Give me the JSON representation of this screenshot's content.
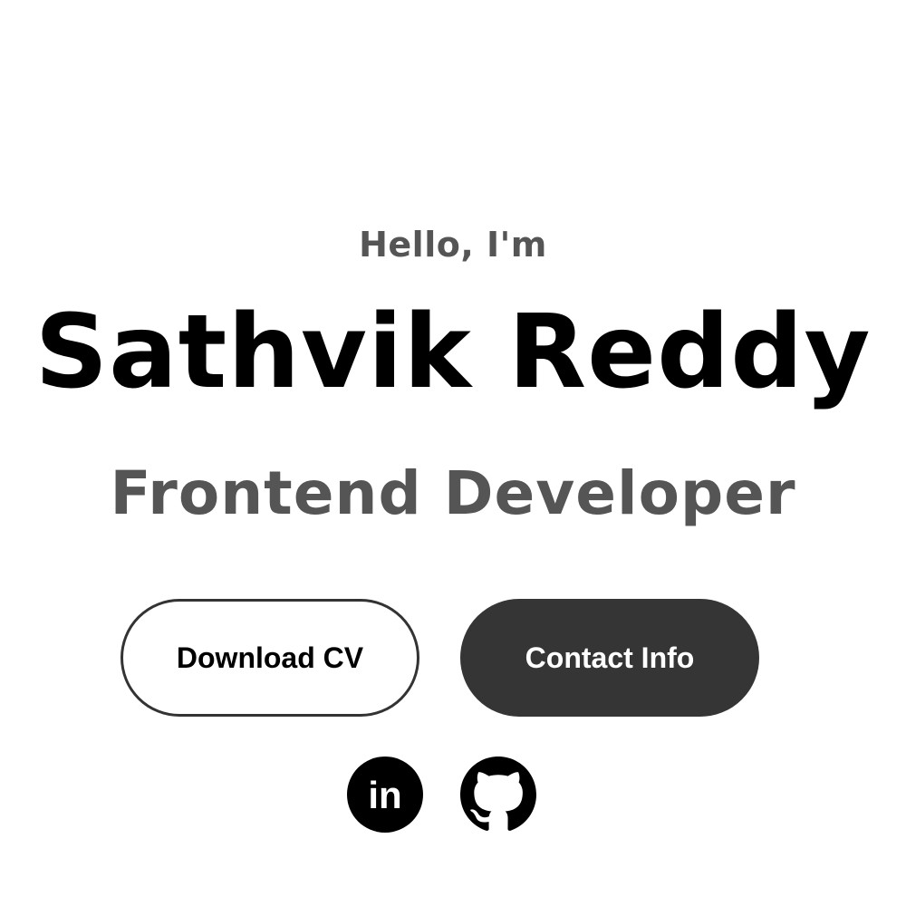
{
  "hero": {
    "greeting": "Hello, I'm",
    "name": "Sathvik Reddy",
    "role": "Frontend Developer"
  },
  "buttons": {
    "download_cv": "Download CV",
    "contact_info": "Contact Info"
  },
  "social": [
    {
      "icon": "linkedin-icon",
      "label": "in"
    },
    {
      "icon": "github-icon"
    }
  ],
  "colors": {
    "primary_text": "#000000",
    "secondary_text": "#555555",
    "button_dark": "#353535",
    "background": "#ffffff"
  }
}
